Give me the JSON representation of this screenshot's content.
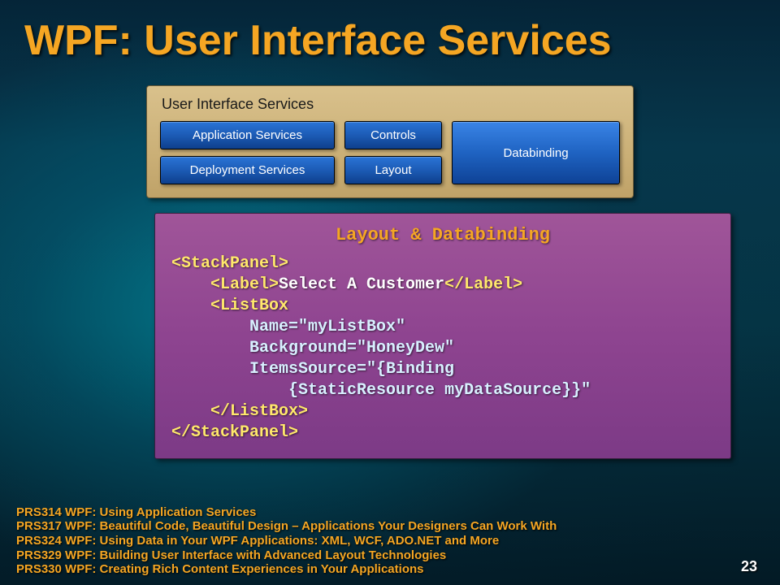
{
  "title": "WPF: User Interface Services",
  "uisPanel": {
    "heading": "User Interface Services",
    "col1": [
      "Application Services",
      "Deployment Services"
    ],
    "col2": [
      "Controls",
      "Layout"
    ],
    "col3": "Databinding"
  },
  "codePanel": {
    "title": "Layout & Databinding",
    "lines": [
      {
        "tag": "<StackPanel>"
      },
      {
        "indent": 1,
        "tagOpen": "<Label>",
        "text": "Select A Customer",
        "tagClose": "</Label>"
      },
      {
        "indent": 1,
        "tag": "<ListBox"
      },
      {
        "indent": 2,
        "attr": "Name=\"myListBox\""
      },
      {
        "indent": 2,
        "attr": "Background=\"HoneyDew\""
      },
      {
        "indent": 2,
        "attr": "ItemsSource=\"{Binding"
      },
      {
        "indent": 3,
        "attr": "{StaticResource myDataSource}}\""
      },
      {
        "indent": 1,
        "tag": "</ListBox>"
      },
      {
        "tag": "</StackPanel>"
      }
    ]
  },
  "sessions": [
    "PRS314 WPF: Using Application Services",
    "PRS317 WPF: Beautiful Code, Beautiful Design – Applications Your Designers Can Work With",
    "PRS324 WPF: Using Data in Your WPF Applications: XML, WCF, ADO.NET and More",
    "PRS329 WPF: Building User Interface with Advanced Layout Technologies",
    "PRS330 WPF: Creating Rich Content Experiences in Your Applications"
  ],
  "pageNumber": "23"
}
